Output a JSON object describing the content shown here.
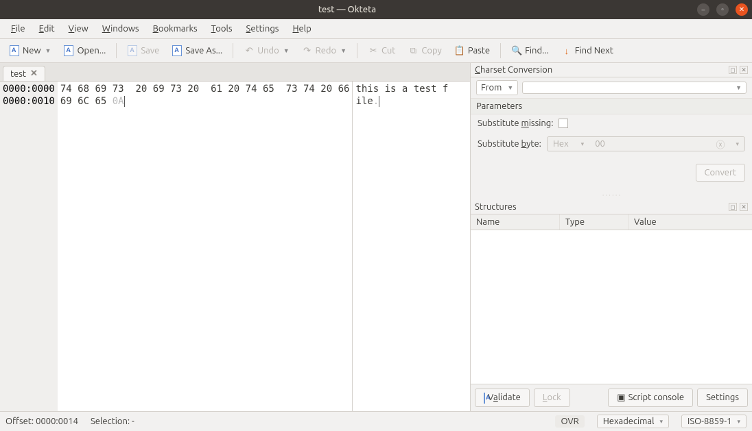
{
  "window": {
    "title": "test — Okteta"
  },
  "menu": {
    "file": "File",
    "edit": "Edit",
    "view": "View",
    "windows": "Windows",
    "bookmarks": "Bookmarks",
    "tools": "Tools",
    "settings": "Settings",
    "help": "Help"
  },
  "toolbar": {
    "new": "New",
    "open": "Open...",
    "save": "Save",
    "saveas": "Save As...",
    "undo": "Undo",
    "redo": "Redo",
    "cut": "Cut",
    "copy": "Copy",
    "paste": "Paste",
    "find": "Find...",
    "findnext": "Find Next"
  },
  "tab": {
    "label": "test"
  },
  "hex": {
    "rows": [
      {
        "offset": "0000:0000",
        "bytes": [
          "74",
          "68",
          "69",
          "73",
          "20",
          "69",
          "73",
          "20",
          "61",
          "20",
          "74",
          "65",
          "73",
          "74",
          "20",
          "66"
        ],
        "ascii": "this is a test f"
      },
      {
        "offset": "0000:0010",
        "bytes": [
          "69",
          "6C",
          "65",
          "0A"
        ],
        "ascii": "ile."
      }
    ]
  },
  "charset": {
    "title": "Charset Conversion",
    "from_label": "From",
    "parameters": "Parameters",
    "sub_missing": "Substitute missing:",
    "sub_byte": "Substitute byte:",
    "hex_hint": "Hex",
    "hex_value": "00",
    "convert": "Convert"
  },
  "structures": {
    "title": "Structures",
    "cols": {
      "name": "Name",
      "type": "Type",
      "value": "Value"
    },
    "validate": "Validate",
    "lock": "Lock",
    "console": "Script console",
    "settings": "Settings"
  },
  "status": {
    "offset": "Offset: 0000:0014",
    "selection": "Selection: -",
    "ovr": "OVR",
    "base": "Hexadecimal",
    "enc": "ISO-8859-1"
  }
}
